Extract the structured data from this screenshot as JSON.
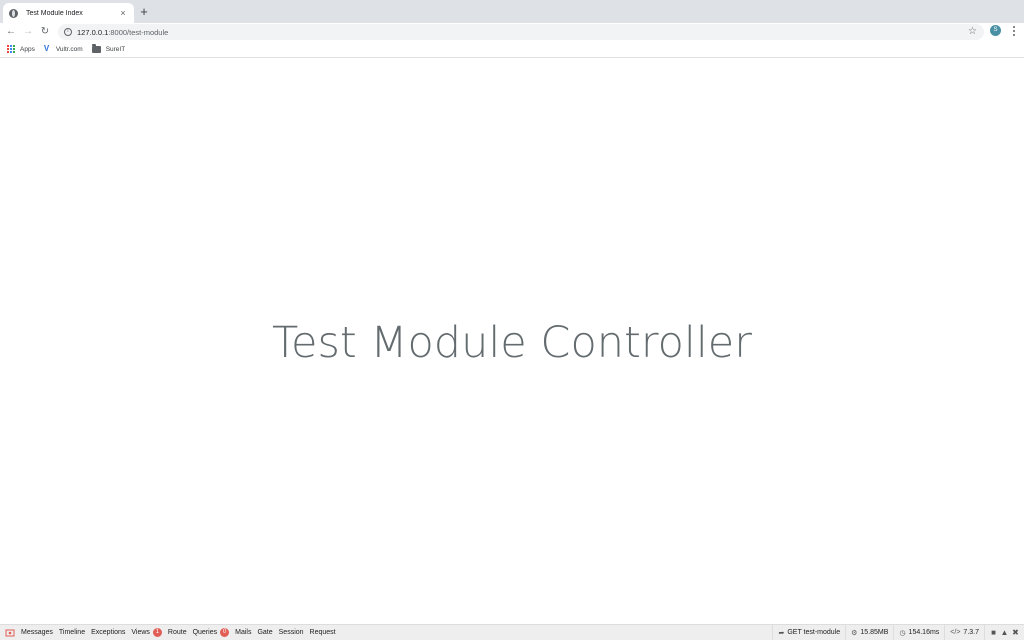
{
  "browser": {
    "tab": {
      "title": "Test Module Index",
      "favicon": "globe-icon",
      "close": "×"
    },
    "new_tab": "+",
    "url": {
      "host": "127.0.0.1",
      "rest": ":8000/test-module"
    },
    "profile_initial": "S",
    "bookmarks": [
      {
        "label": "Apps",
        "icon": "apps-grid-icon"
      },
      {
        "label": "Vultr.com",
        "icon": "vultr-icon"
      },
      {
        "label": "SureIT",
        "icon": "folder-icon"
      }
    ]
  },
  "page": {
    "heading": "Test Module Controller"
  },
  "debugbar": {
    "tabs": [
      {
        "label": "Messages"
      },
      {
        "label": "Timeline"
      },
      {
        "label": "Exceptions"
      },
      {
        "label": "Views",
        "badge": "1"
      },
      {
        "label": "Route"
      },
      {
        "label": "Queries",
        "badge": "0"
      },
      {
        "label": "Mails"
      },
      {
        "label": "Gate"
      },
      {
        "label": "Session"
      },
      {
        "label": "Request"
      }
    ],
    "request": "GET test-module",
    "memory": "15.85MB",
    "duration": "154.16ms",
    "php_version": "7.3.7",
    "badge_color": "#e15e56"
  }
}
